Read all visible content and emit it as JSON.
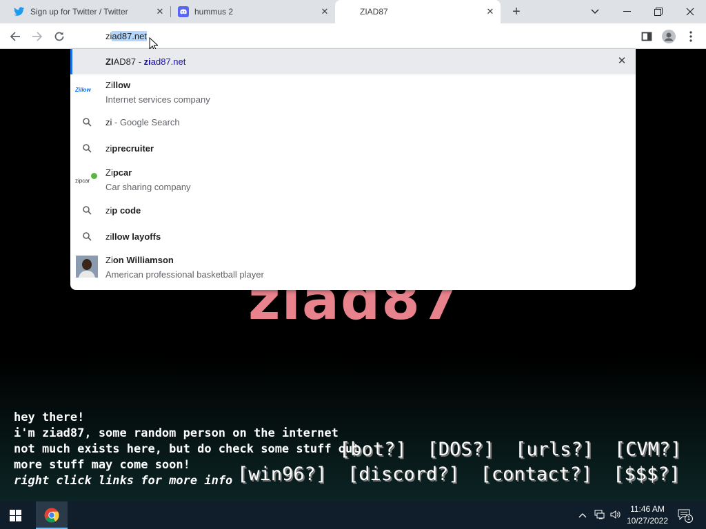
{
  "tabs": [
    {
      "title": "Sign up for Twitter / Twitter",
      "icon": "twitter-icon"
    },
    {
      "title": "hummus 2",
      "icon": "discord-icon"
    },
    {
      "title": "ZIAD87",
      "icon": "none"
    }
  ],
  "omnibox": {
    "typed": "zi",
    "completion": "ad87.net"
  },
  "suggestions": [
    {
      "bold": "ZI",
      "rest": "AD87 - ",
      "url_bold": "zi",
      "url_rest": "ad87.net"
    },
    {
      "plain": "Zi",
      "bold": "llow",
      "sub": "Internet services company",
      "logo": "Zillow"
    },
    {
      "plain": "zi",
      "rest": " - Google Search"
    },
    {
      "plain": "zi",
      "bold": "precruiter"
    },
    {
      "plain": "Zi",
      "bold": "pcar",
      "sub": "Car sharing company",
      "logo": "zipcar"
    },
    {
      "plain": "zi",
      "bold": "p code"
    },
    {
      "plain": "zi",
      "bold": "llow layoffs"
    },
    {
      "plain": "Zi",
      "bold": "on Williamson",
      "sub": "American professional basketball player"
    }
  ],
  "page": {
    "title": "ziad87",
    "intro": [
      "hey there!",
      "i'm ziad87, some random person on the internet",
      "not much exists here, but do check some stuff out",
      "more stuff may come soon!",
      "right click links for more info"
    ],
    "links_row1": [
      "[bot?]",
      "[DOS?]",
      "[urls?]",
      "[CVM?]"
    ],
    "links_row2": [
      "[win96?]",
      "[discord?]",
      "[contact?]",
      "[$$$?]"
    ]
  },
  "clock": {
    "time": "11:46 AM",
    "date": "10/27/2022"
  },
  "notifications": "1",
  "colors": {
    "accent": "#1a73e8",
    "title_pink": "#e8828c"
  }
}
